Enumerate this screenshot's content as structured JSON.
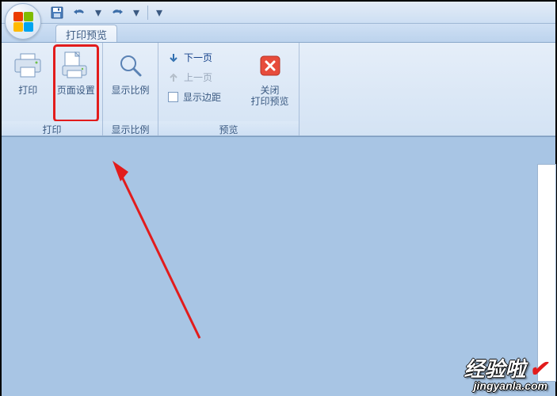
{
  "qat": {
    "save_title": "保存",
    "undo_title": "撤销",
    "redo_title": "重做"
  },
  "tab": {
    "label": "打印预览"
  },
  "ribbon": {
    "group_print": {
      "print_label": "打印",
      "page_setup_label": "页面设置",
      "group_label": "打印"
    },
    "group_zoom": {
      "zoom_label": "显示比例",
      "group_label": "显示比例"
    },
    "group_preview": {
      "next_page_label": "下一页",
      "prev_page_label": "上一页",
      "show_margins_label": "显示边距",
      "close_label_line1": "关闭",
      "close_label_line2": "打印预览",
      "group_label": "预览"
    }
  },
  "watermark": {
    "line1": "经验啦",
    "check": "✔",
    "line2": "jingyanla.com"
  },
  "colors": {
    "highlight": "#e21c1c",
    "ribbon_bg": "#d4e3f4",
    "doc_bg": "#a8c5e4"
  }
}
